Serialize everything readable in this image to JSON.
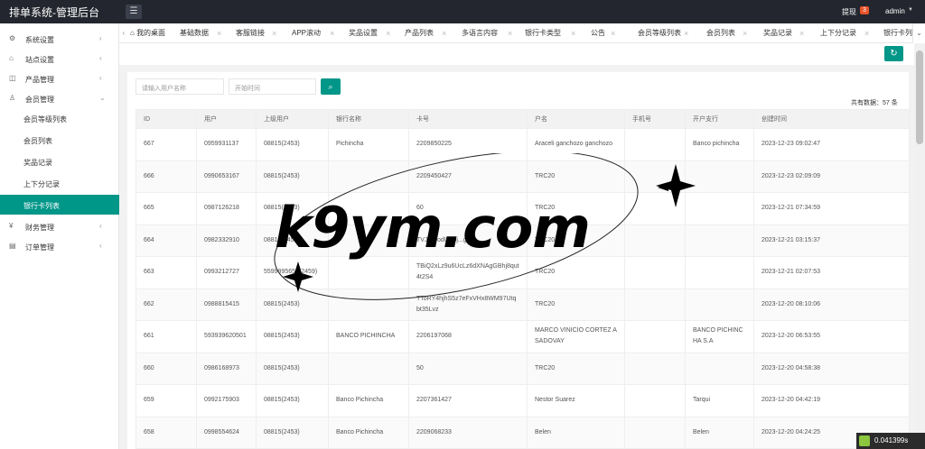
{
  "header": {
    "title": "排单系统-管理后台",
    "menu_toggle_icon": "menu-icon",
    "withdraw_label": "提现",
    "withdraw_count": "3",
    "user": "admin"
  },
  "sidebar": {
    "items": [
      {
        "label": "系统设置",
        "icon": "gear-icon"
      },
      {
        "label": "站点设置",
        "icon": "home-icon"
      },
      {
        "label": "产品管理",
        "icon": "box-icon"
      },
      {
        "label": "会员管理",
        "icon": "user-icon"
      },
      {
        "label": "财务管理",
        "icon": "yen-icon"
      },
      {
        "label": "订单管理",
        "icon": "order-icon"
      }
    ],
    "member_sub": [
      {
        "label": "会员等级列表"
      },
      {
        "label": "会员列表"
      },
      {
        "label": "奖品记录"
      },
      {
        "label": "上下分记录"
      },
      {
        "label": "银行卡列表"
      }
    ]
  },
  "tabs": [
    {
      "label": "我的桌面"
    },
    {
      "label": "基础数据"
    },
    {
      "label": "客服链接"
    },
    {
      "label": "APP滚动"
    },
    {
      "label": "奖品设置"
    },
    {
      "label": "产品列表"
    },
    {
      "label": "多语言内容"
    },
    {
      "label": "银行卡类型"
    },
    {
      "label": "公告"
    },
    {
      "label": "会员等级列表"
    },
    {
      "label": "会员列表"
    },
    {
      "label": "奖品记录"
    },
    {
      "label": "上下分记录"
    },
    {
      "label": "银行卡列"
    }
  ],
  "filters": {
    "username_placeholder": "请输入用户名称",
    "start_time_placeholder": "开始时间"
  },
  "total_label": "共有数据：57 条",
  "table": {
    "columns": [
      "ID",
      "用户",
      "上级用户",
      "银行名称",
      "卡号",
      "户名",
      "手机号",
      "开户支行",
      "创建时间"
    ],
    "rows": [
      [
        "667",
        "0959931137",
        "08815(2453)",
        "Pichincha",
        "2209850225",
        "Araceli ganchozo ganchozo",
        "",
        "Banco pichincha",
        "2023-12-23 09:02:47"
      ],
      [
        "666",
        "0990653167",
        "08815(2453)",
        "",
        "2209450427",
        "TRC20",
        "",
        "",
        "2023-12-23 02:09:09"
      ],
      [
        "665",
        "0987126218",
        "08815(2453)",
        "",
        "60",
        "TRC20",
        "",
        "",
        "2023-12-21 07:34:59"
      ],
      [
        "664",
        "0982332910",
        "08815(2453)",
        "",
        "TVJ...PodUSoj...gEC...",
        "TRC20",
        "",
        "",
        "2023-12-21 03:15:37"
      ],
      [
        "663",
        "0993212727",
        "5599995655(2459)",
        "",
        "TBiQ2xLz9u6UcLz6dXNAgGBhj8qut4t2S4",
        "TRC20",
        "",
        "",
        "2023-12-21 02:07:53"
      ],
      [
        "662",
        "0988815415",
        "08815(2453)",
        "",
        "TToRY4hjhS5z7eFxVHx8WM97Utqbt35Lvz",
        "TRC20",
        "",
        "",
        "2023-12-20 08:10:06"
      ],
      [
        "661",
        "593939620501",
        "08815(2453)",
        "BANCO PICHINCHA",
        "2206197068",
        "MARCO VINICIO CORTEZ ASADOVAY",
        "",
        "BANCO PICHINCHA S.A",
        "2023-12-20 06:53:55"
      ],
      [
        "660",
        "0986168973",
        "08815(2453)",
        "",
        "50",
        "TRC20",
        "",
        "",
        "2023-12-20 04:58:38"
      ],
      [
        "659",
        "0992175903",
        "08815(2453)",
        "Banco Pichincha",
        "2207361427",
        "Nestor Suarez",
        "",
        "Tarqui",
        "2023-12-20 04:42:19"
      ],
      [
        "658",
        "0998554624",
        "08815(2453)",
        "Banco Pichincha",
        "2209068233",
        "Belen",
        "",
        "Belen",
        "2023-12-20 04:24:25"
      ]
    ]
  },
  "watermark": "k9ym.com",
  "timer": "0.041399s",
  "colors": {
    "accent": "#009688",
    "header_bg": "#23262e"
  }
}
